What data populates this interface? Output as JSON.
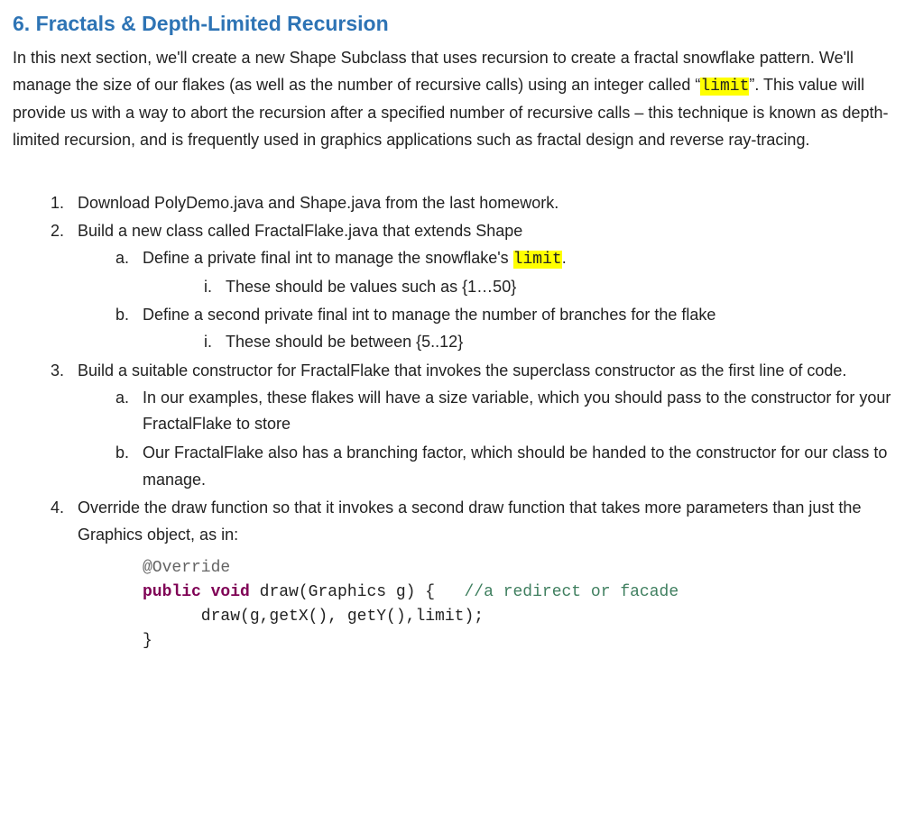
{
  "heading": "6. Fractals & Depth-Limited Recursion",
  "intro": {
    "t1": "In this next section, we'll create a new Shape Subclass that uses recursion to create a fractal snowflake pattern.  We'll manage the size of our flakes (as well as the number of recursive calls) using an integer called “",
    "limit": "limit",
    "t2": "”.  This value will provide us with a way to abort the recursion after a specified number of recursive calls – this technique is known as depth-limited recursion, and is frequently used in graphics applications such as fractal design and reverse ray-tracing."
  },
  "steps": {
    "s1": "Download PolyDemo.java and Shape.java from the last homework.",
    "s2": "Build a new class called FractalFlake.java that extends Shape",
    "s2a_pre": "Define a private final int to manage the snowflake's ",
    "s2a_hl": "limit",
    "s2a_post": ".",
    "s2a_i": "These should be values such as {1…50}",
    "s2b": "Define a second private final int to manage the number of branches for the flake",
    "s2b_i": "These should be between {5..12}",
    "s3": "Build a suitable constructor for FractalFlake that invokes the superclass constructor as the first line of code.",
    "s3a": "In our examples, these flakes will have a size variable, which you should pass to the constructor for your FractalFlake to store",
    "s3b": "Our FractalFlake also has a branching factor, which should be handed to the constructor for our class to manage.",
    "s4": "Override the draw function so that it invokes a second draw function that takes more parameters than just the Graphics object, as in:"
  },
  "code": {
    "ann": "@Override",
    "kw1": "public",
    "kw2": "void",
    "sig": " draw(Graphics g) {   ",
    "cmt": "//a redirect or facade",
    "body": "      draw(g,getX(), getY(),limit);",
    "close": "}"
  }
}
